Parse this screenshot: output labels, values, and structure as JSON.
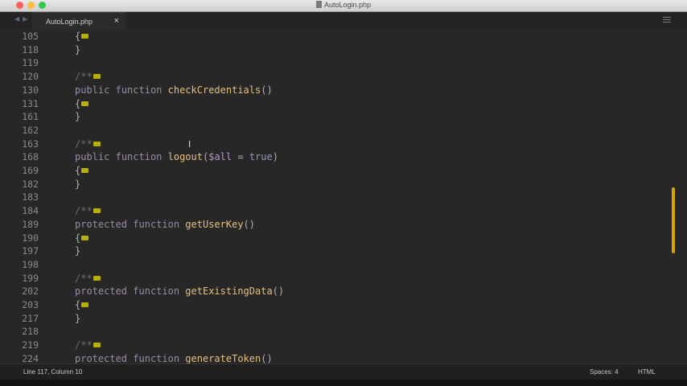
{
  "window": {
    "title": "AutoLogin.php"
  },
  "tabs": [
    {
      "label": "AutoLogin.php",
      "close": "×"
    }
  ],
  "editor": {
    "lines": [
      {
        "num": "105",
        "code": [
          {
            "t": "{",
            "c": "pun"
          },
          {
            "fold": true
          }
        ]
      },
      {
        "num": "118",
        "code": [
          {
            "t": "}",
            "c": "pun"
          }
        ]
      },
      {
        "num": "119",
        "code": []
      },
      {
        "num": "120",
        "code": [
          {
            "t": "/**",
            "c": "cm"
          },
          {
            "fold": true
          }
        ]
      },
      {
        "num": "130",
        "code": [
          {
            "t": "public",
            "c": "kw"
          },
          {
            "t": " "
          },
          {
            "t": "function",
            "c": "kw"
          },
          {
            "t": " "
          },
          {
            "t": "checkCredentials",
            "c": "fn"
          },
          {
            "t": "()",
            "c": "pun"
          }
        ]
      },
      {
        "num": "131",
        "code": [
          {
            "t": "{",
            "c": "pun"
          },
          {
            "fold": true
          }
        ]
      },
      {
        "num": "161",
        "code": [
          {
            "t": "}",
            "c": "pun"
          }
        ]
      },
      {
        "num": "162",
        "code": []
      },
      {
        "num": "163",
        "code": [
          {
            "t": "/**",
            "c": "cm"
          },
          {
            "fold": true
          }
        ]
      },
      {
        "num": "168",
        "code": [
          {
            "t": "public",
            "c": "kw"
          },
          {
            "t": " "
          },
          {
            "t": "function",
            "c": "kw"
          },
          {
            "t": " "
          },
          {
            "t": "logout",
            "c": "fn"
          },
          {
            "t": "(",
            "c": "pun"
          },
          {
            "t": "$all",
            "c": "var"
          },
          {
            "t": " = ",
            "c": "pun"
          },
          {
            "t": "true",
            "c": "lit"
          },
          {
            "t": ")",
            "c": "pun"
          }
        ]
      },
      {
        "num": "169",
        "code": [
          {
            "t": "{",
            "c": "pun"
          },
          {
            "fold": true
          }
        ]
      },
      {
        "num": "182",
        "code": [
          {
            "t": "}",
            "c": "pun"
          }
        ]
      },
      {
        "num": "183",
        "code": []
      },
      {
        "num": "184",
        "code": [
          {
            "t": "/**",
            "c": "cm"
          },
          {
            "fold": true
          }
        ]
      },
      {
        "num": "189",
        "code": [
          {
            "t": "protected",
            "c": "kw"
          },
          {
            "t": " "
          },
          {
            "t": "function",
            "c": "kw"
          },
          {
            "t": " "
          },
          {
            "t": "getUserKey",
            "c": "fn"
          },
          {
            "t": "()",
            "c": "pun"
          }
        ]
      },
      {
        "num": "190",
        "code": [
          {
            "t": "{",
            "c": "pun"
          },
          {
            "fold": true
          }
        ]
      },
      {
        "num": "197",
        "code": [
          {
            "t": "}",
            "c": "pun"
          }
        ]
      },
      {
        "num": "198",
        "code": []
      },
      {
        "num": "199",
        "code": [
          {
            "t": "/**",
            "c": "cm"
          },
          {
            "fold": true
          }
        ]
      },
      {
        "num": "202",
        "code": [
          {
            "t": "protected",
            "c": "kw"
          },
          {
            "t": " "
          },
          {
            "t": "function",
            "c": "kw"
          },
          {
            "t": " "
          },
          {
            "t": "getExistingData",
            "c": "fn"
          },
          {
            "t": "()",
            "c": "pun"
          }
        ]
      },
      {
        "num": "203",
        "code": [
          {
            "t": "{",
            "c": "pun"
          },
          {
            "fold": true
          }
        ]
      },
      {
        "num": "217",
        "code": [
          {
            "t": "}",
            "c": "pun"
          }
        ]
      },
      {
        "num": "218",
        "code": []
      },
      {
        "num": "219",
        "code": [
          {
            "t": "/**",
            "c": "cm"
          },
          {
            "fold": true
          }
        ]
      },
      {
        "num": "224",
        "code": [
          {
            "t": "protected",
            "c": "kw"
          },
          {
            "t": " "
          },
          {
            "t": "function",
            "c": "kw"
          },
          {
            "t": " "
          },
          {
            "t": "generateToken",
            "c": "fn"
          },
          {
            "t": "()",
            "c": "pun"
          }
        ]
      }
    ]
  },
  "status": {
    "position": "Line 117, Column 10",
    "indent": "Spaces: 4",
    "syntax": "HTML"
  },
  "colors": {
    "background": "#272727",
    "keyword": "#9a8aa6",
    "function_name": "#e6c07b",
    "variable": "#b49ad0",
    "fold_marker": "#b8b000",
    "scroll_thumb": "#d8a400"
  }
}
